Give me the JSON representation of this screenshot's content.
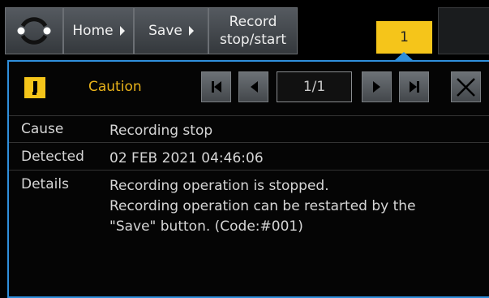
{
  "toolbar": {
    "home_label": "Home",
    "save_label": "Save",
    "record_line1": "Record",
    "record_line2": "stop/start",
    "alert_tab_label": "1"
  },
  "alert": {
    "severity": "Caution",
    "page": "1/1",
    "accent_color": "#2f8fdc",
    "caution_color": "#f5c51a",
    "fields": {
      "cause_label": "Cause",
      "cause_value": "Recording stop",
      "detected_label": "Detected",
      "detected_value": "02 FEB 2021 04:46:06",
      "details_label": "Details",
      "details_line1": "Recording operation is stopped.",
      "details_line2": "Recording operation can be restarted by the",
      "details_line3": "\"Save\" button. (Code:#001)"
    }
  },
  "icons": [
    "menu-ring-icon",
    "warning-icon",
    "first-page-icon",
    "prev-page-icon",
    "next-page-icon",
    "last-page-icon",
    "close-icon"
  ]
}
